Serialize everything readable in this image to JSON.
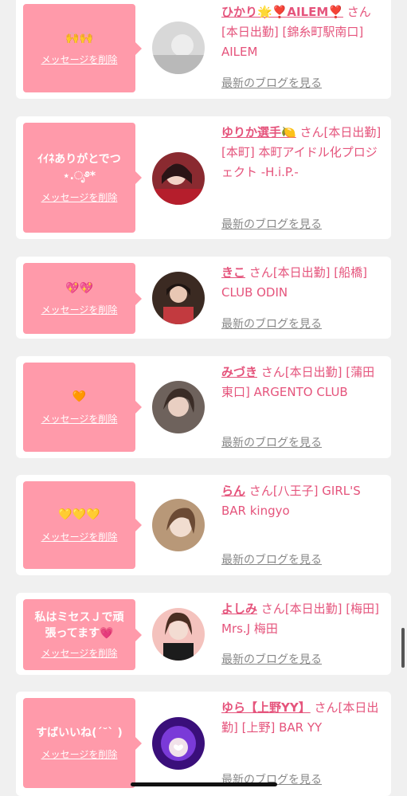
{
  "cards": [
    {
      "message": "🙌🙌",
      "delete_label": "メッセージを削除",
      "name": "ひかり🌟❣️AILEM❣️",
      "suffix": "さん",
      "details": "[本日出勤] [錦糸町駅南口] AILEM",
      "blog_label": "最新のブログを見る",
      "avatar_color": "#cfcfcf"
    },
    {
      "message": "ｲｲﾈありがとでつ⋆.ೃ࿔*",
      "delete_label": "メッセージを削除",
      "name": "ゆりか選手🍋",
      "suffix": "さん",
      "details": "[本日出勤] [本町] 本町アイドル化プロジェクト -H.i.P.-",
      "blog_label": "最新のブログを見る",
      "avatar_color": "#7a1b24"
    },
    {
      "message": "💖💖",
      "delete_label": "メッセージを削除",
      "name": "きこ",
      "suffix": "さん",
      "details": "[本日出勤] [船橋] CLUB ODIN",
      "blog_label": "最新のブログを見る",
      "avatar_color": "#6b4a3a"
    },
    {
      "message": "🧡",
      "delete_label": "メッセージを削除",
      "name": "みづき",
      "suffix": "さん",
      "details": "[本日出勤] [蒲田東口] ARGENTO CLUB",
      "blog_label": "最新のブログを見る",
      "avatar_color": "#5a4a46"
    },
    {
      "message": "💛💛💛",
      "delete_label": "メッセージを削除",
      "name": "らん",
      "suffix": "さん",
      "details": "[八王子] GIRL'S BAR kingyo",
      "blog_label": "最新のブログを見る",
      "avatar_color": "#c9a88a"
    },
    {
      "message": "私はミセスＪで頑張ってます💗",
      "delete_label": "メッセージを削除",
      "name": "よしみ",
      "suffix": "さん",
      "details": "[本日出勤] [梅田] Mrs.J 梅田",
      "blog_label": "最新のブログを見る",
      "avatar_color": "#f2b7b2"
    },
    {
      "message": "すばいいね(ˊ˘ˋ )",
      "delete_label": "メッセージを削除",
      "name": "ゆら【上野YY】",
      "suffix": "さん",
      "details": "[本日出勤] [上野] BAR YY",
      "blog_label": "最新のブログを見る",
      "avatar_color": "#4a1a9a"
    }
  ],
  "theme": {
    "bubble": "#ff9aaa",
    "accent": "#e5547c",
    "link_gray": "#888888"
  }
}
